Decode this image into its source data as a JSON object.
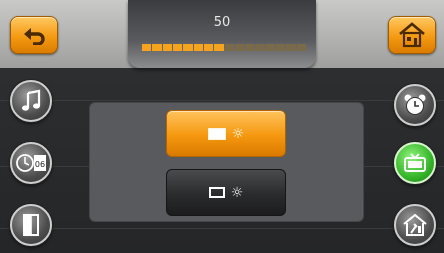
{
  "header": {
    "value": "50",
    "level_fraction": 0.5,
    "segments_total": 16
  },
  "buttons": {
    "back": {
      "icon": "back-arrow-icon"
    },
    "home": {
      "icon": "home-icon"
    }
  },
  "left_sidebar": [
    {
      "name": "music",
      "icon": "music-note-icon"
    },
    {
      "name": "clock-date",
      "icon": "clock-calendar-icon",
      "text": "06"
    },
    {
      "name": "door",
      "icon": "door-exit-icon"
    }
  ],
  "right_sidebar": [
    {
      "name": "alarm",
      "icon": "alarm-clock-icon"
    },
    {
      "name": "tv",
      "icon": "tv-icon",
      "active": true
    },
    {
      "name": "tools",
      "icon": "tools-icon"
    }
  ],
  "mode_options": [
    {
      "name": "brightness-filled",
      "icon_rect": "filled-rectangle-icon",
      "icon_sun": "sun-icon",
      "sun_glyph": "☼",
      "selected": true
    },
    {
      "name": "brightness-outline",
      "icon_rect": "outline-rectangle-icon",
      "icon_sun": "sun-icon",
      "sun_glyph": "☼",
      "selected": false
    }
  ],
  "colors": {
    "accent_orange": "#f59a12",
    "active_green": "#35b52a",
    "background": "#2b2c2e"
  }
}
